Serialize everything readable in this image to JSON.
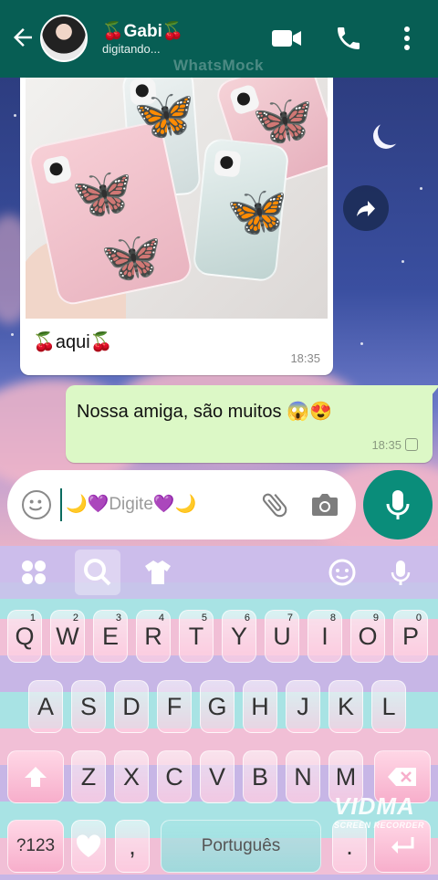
{
  "header": {
    "contact_name": "🍒Gabi🍒",
    "status": "digitando...",
    "watermark": "WhatsMock"
  },
  "messages": {
    "incoming": {
      "caption": "🍒aqui🍒",
      "time": "18:35"
    },
    "outgoing": {
      "text": "Nossa amiga, são muitos 😱😍",
      "time": "18:35"
    }
  },
  "composer": {
    "placeholder": "🌙💜Digite💜🌙"
  },
  "keyboard": {
    "row1": [
      {
        "key": "Q",
        "hint": "1"
      },
      {
        "key": "W",
        "hint": "2"
      },
      {
        "key": "E",
        "hint": "3"
      },
      {
        "key": "R",
        "hint": "4"
      },
      {
        "key": "T",
        "hint": "5"
      },
      {
        "key": "Y",
        "hint": "6"
      },
      {
        "key": "U",
        "hint": "7"
      },
      {
        "key": "I",
        "hint": "8"
      },
      {
        "key": "O",
        "hint": "9"
      },
      {
        "key": "P",
        "hint": "0"
      }
    ],
    "row2": [
      "A",
      "S",
      "D",
      "F",
      "G",
      "H",
      "J",
      "K",
      "L"
    ],
    "row3": [
      "Z",
      "X",
      "C",
      "V",
      "B",
      "N",
      "M"
    ],
    "symbols_label": "?123",
    "comma": ",",
    "period": ".",
    "space_label": "Português"
  },
  "recorder_watermark": {
    "brand": "VIDMA",
    "sub": "SCREEN RECORDER"
  },
  "colors": {
    "header": "#075e54",
    "outgoing_bubble": "#dcf8c6",
    "accent": "#0a8d7a"
  }
}
